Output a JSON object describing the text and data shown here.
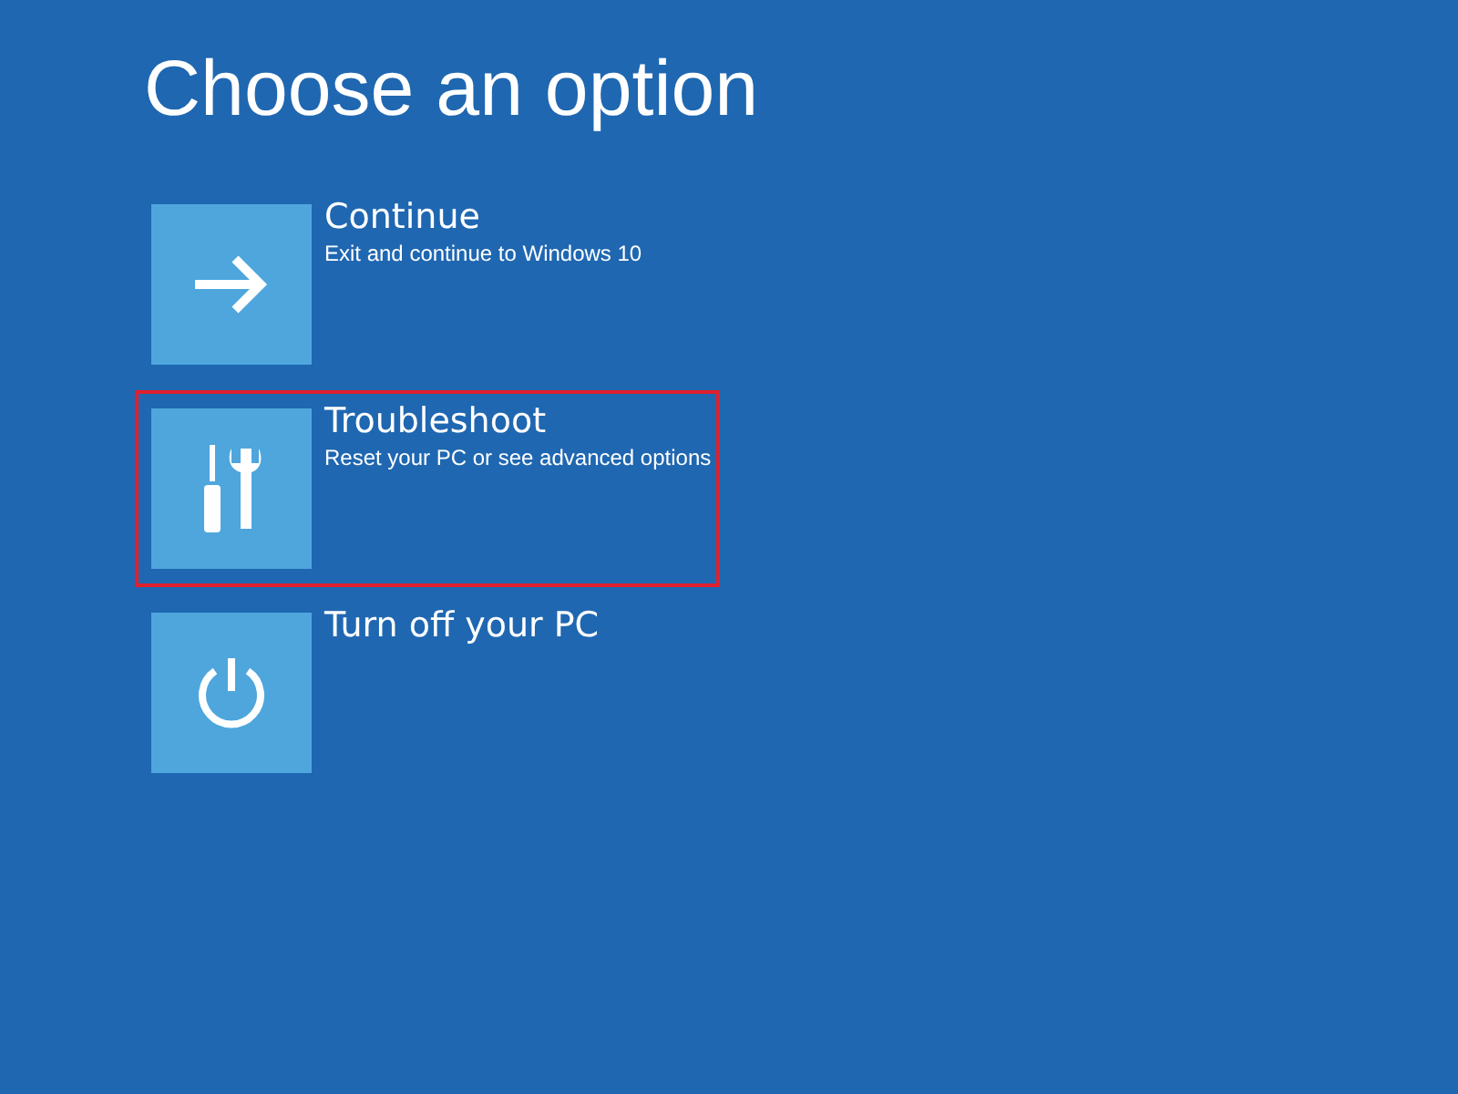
{
  "title": "Choose an option",
  "options": [
    {
      "kind": "arrow",
      "label": "Continue",
      "description": "Exit and continue to Windows 10",
      "highlighted": false
    },
    {
      "kind": "tools",
      "label": "Troubleshoot",
      "description": "Reset your PC or see advanced options",
      "highlighted": true
    },
    {
      "kind": "power",
      "label": "Turn off your PC",
      "highlighted": false
    }
  ]
}
